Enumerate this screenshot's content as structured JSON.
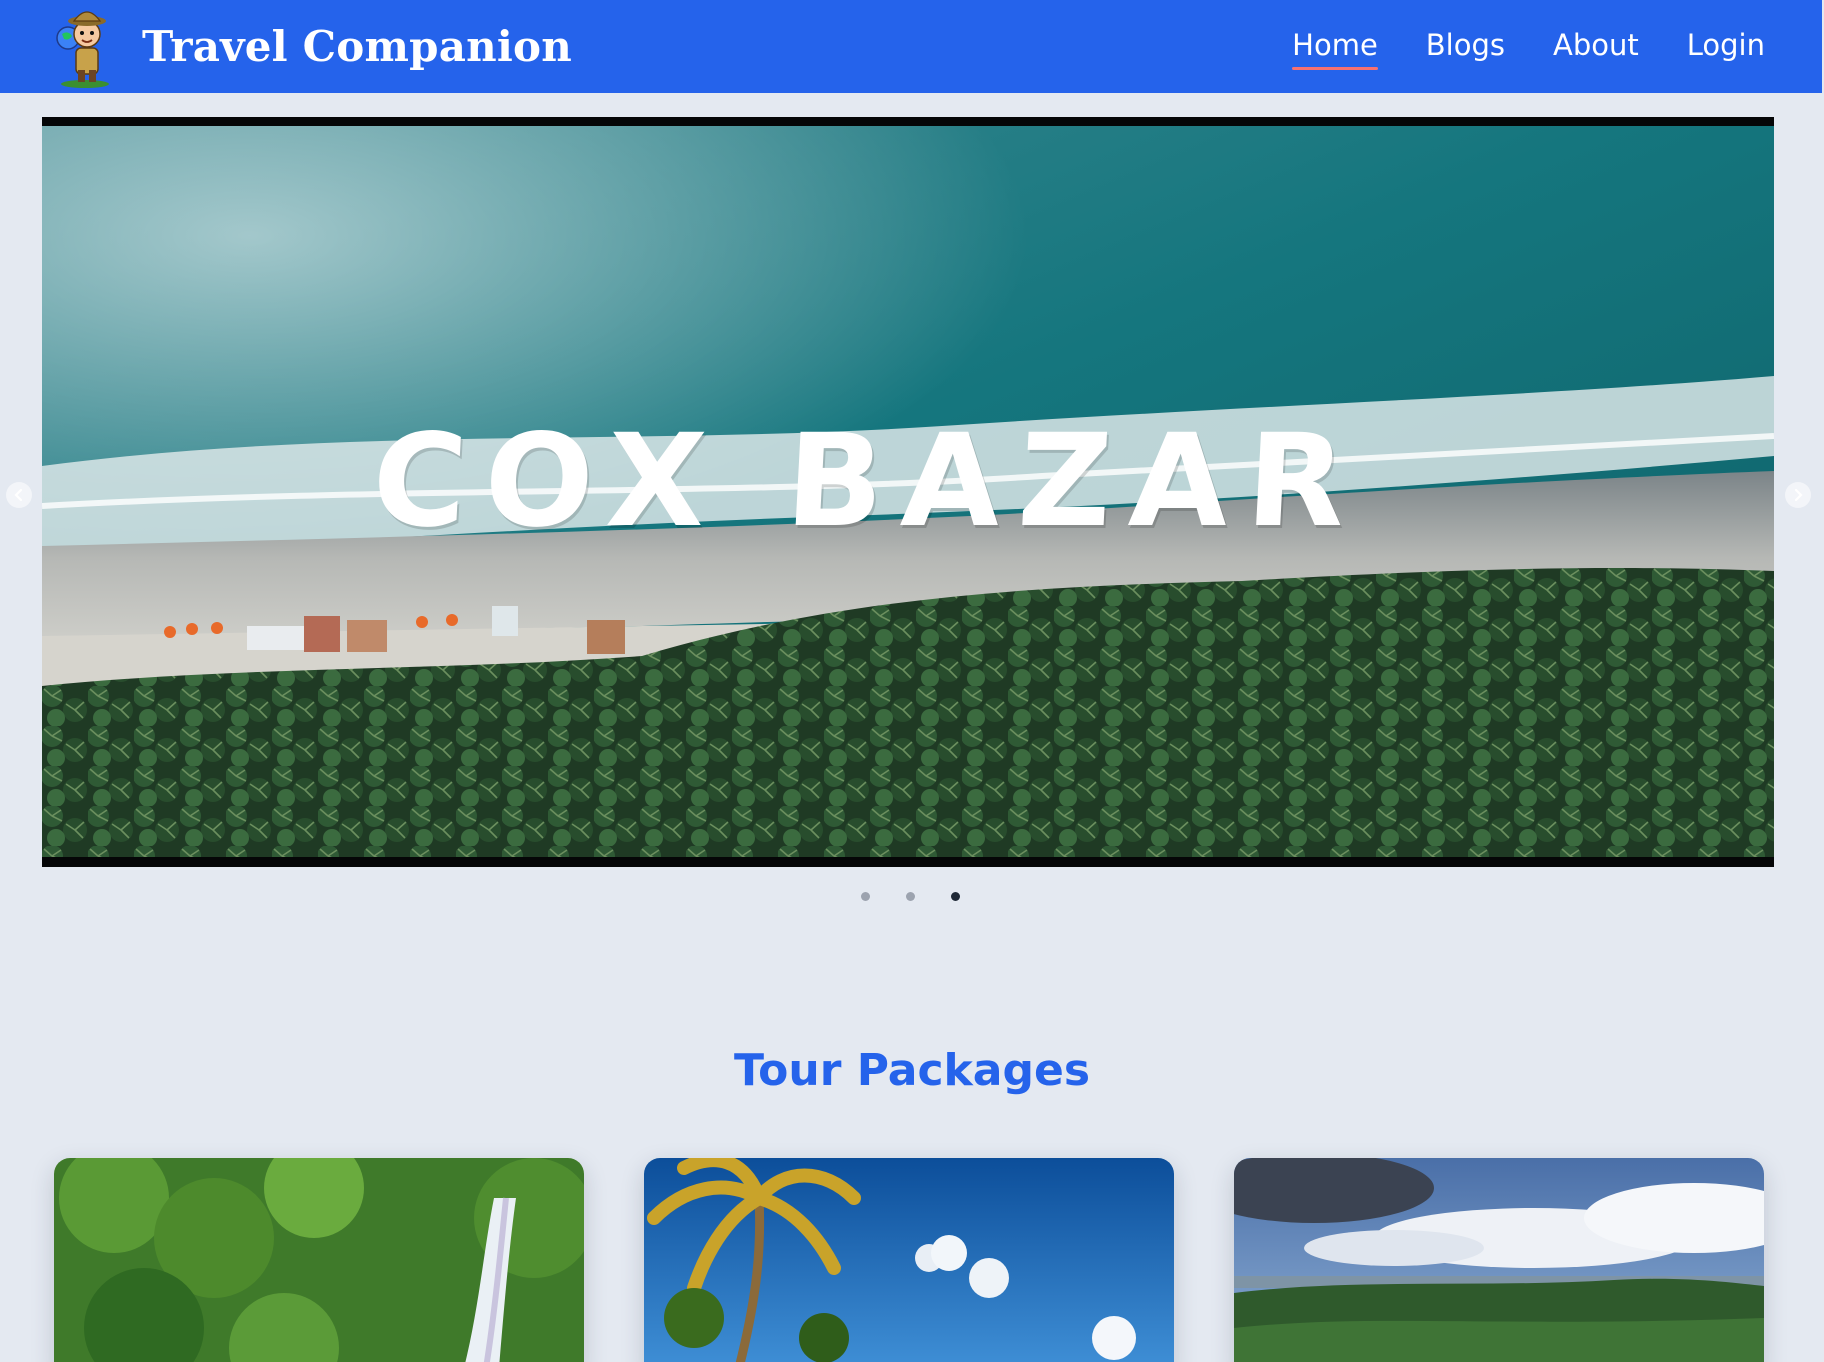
{
  "navbar": {
    "brand": "Travel Companion",
    "logo_icon": "explorer-mascot-icon",
    "links": [
      {
        "label": "Home",
        "active": true
      },
      {
        "label": "Blogs",
        "active": false
      },
      {
        "label": "About",
        "active": false
      },
      {
        "label": "Login",
        "active": false
      }
    ],
    "colors": {
      "background": "#2563eb",
      "active_underline": "#f87171"
    }
  },
  "carousel": {
    "caption": "COX BAZAR",
    "image": "aerial beach with palm trees and sea",
    "dots": [
      false,
      false,
      true
    ],
    "prev_icon": "chevron-left-icon",
    "next_icon": "chevron-right-icon"
  },
  "packages": {
    "title": "Tour Packages",
    "cards": [
      {
        "image": "waterfall in green forest"
      },
      {
        "image": "palm tree under blue sky"
      },
      {
        "image": "cloudy sky over green hills"
      }
    ]
  },
  "colors": {
    "page_background": "#e4e9f1",
    "heading": "#2563eb"
  }
}
